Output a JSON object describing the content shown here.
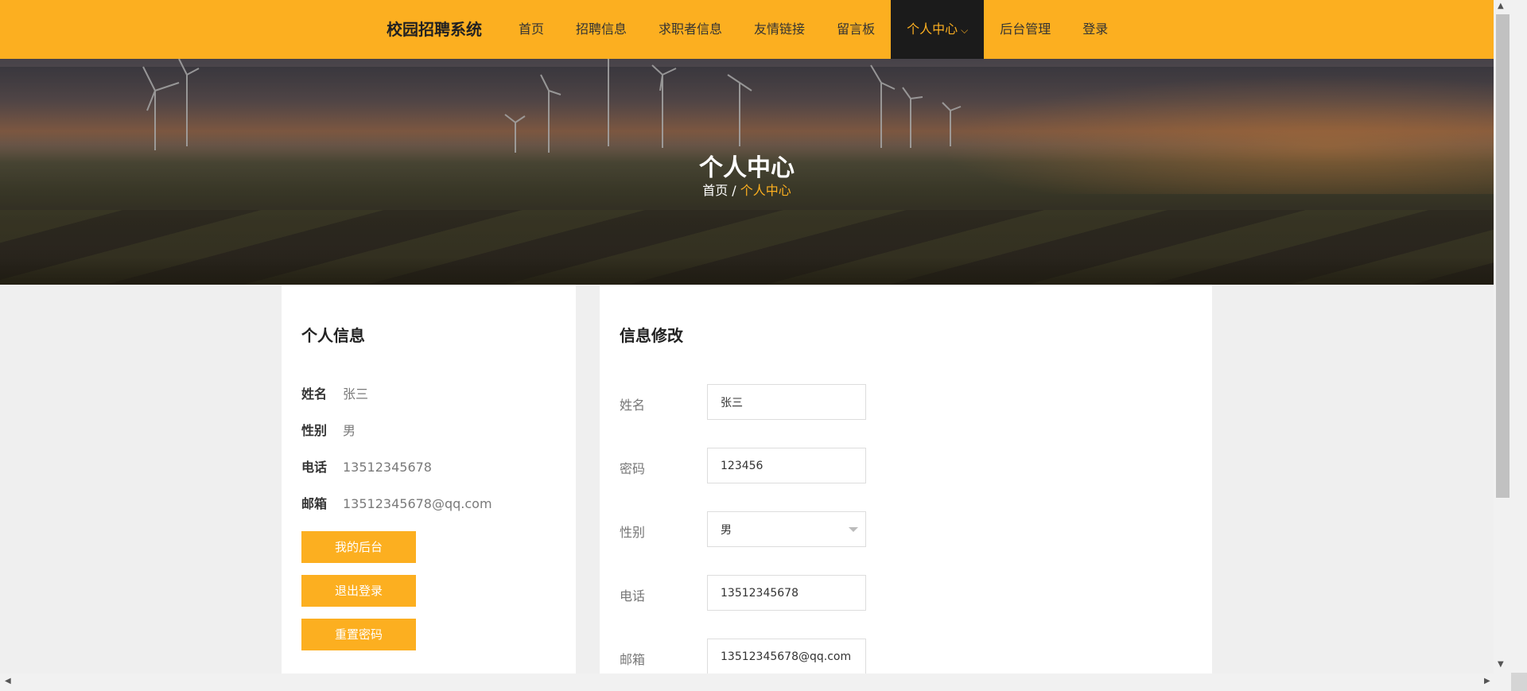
{
  "brand": "校园招聘系统",
  "nav": {
    "items": [
      "首页",
      "招聘信息",
      "求职者信息",
      "友情链接",
      "留言板",
      "个人中心",
      "后台管理",
      "登录"
    ],
    "active_index": 5
  },
  "hero": {
    "title": "个人中心",
    "breadcrumb_home": "首页",
    "breadcrumb_sep": " / ",
    "breadcrumb_current": "个人中心"
  },
  "left_panel": {
    "title": "个人信息",
    "fields": [
      {
        "label": "姓名",
        "value": "张三"
      },
      {
        "label": "性别",
        "value": "男"
      },
      {
        "label": "电话",
        "value": "13512345678"
      },
      {
        "label": "邮箱",
        "value": "13512345678@qq.com"
      }
    ],
    "buttons": [
      "我的后台",
      "退出登录",
      "重置密码"
    ]
  },
  "right_panel": {
    "title": "信息修改",
    "fields": [
      {
        "label": "姓名",
        "value": "张三"
      },
      {
        "label": "密码",
        "value": "123456"
      },
      {
        "label": "性别",
        "value": "男"
      },
      {
        "label": "电话",
        "value": "13512345678"
      },
      {
        "label": "邮箱",
        "value": "13512345678@qq.com"
      }
    ]
  },
  "colors": {
    "accent": "#fcaf20",
    "nav_active_bg": "#1b1b1b",
    "page_bg": "#efefef"
  },
  "icons": {
    "nav_dropdown": "chevron-down-icon",
    "select_arrow": "caret-down-icon"
  }
}
